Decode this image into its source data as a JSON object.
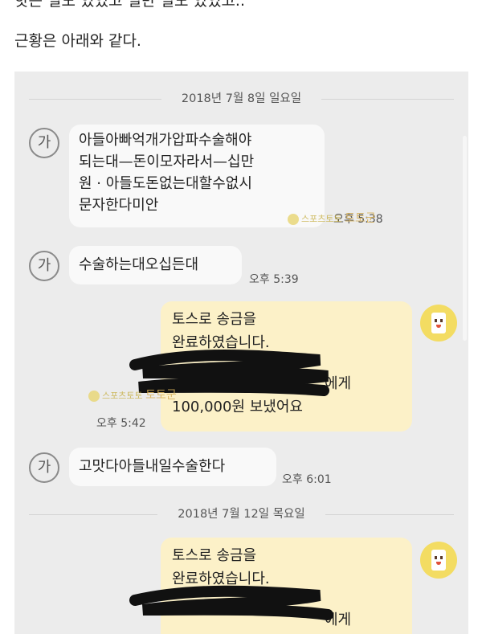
{
  "post": {
    "top_cut_text": "핫는 일도 있었고 일반 일도 있었고..",
    "intro_text": "근황은 아래와 같다."
  },
  "chat": {
    "dates": [
      "2018년 7월 8일 일요일",
      "2018년 7월 12일 목요일"
    ],
    "incoming_avatar_label": "가",
    "messages": [
      {
        "type": "in",
        "lines": [
          "아들아빠억개가압파수술해야",
          "되는대—돈이모자라서—십만",
          "원 · 아들도돈없는대할수없시",
          "문자한다미안"
        ],
        "time": "오후 5:38"
      },
      {
        "type": "in",
        "lines": [
          "수술하는대오십든대"
        ],
        "time": "오후 5:39"
      },
      {
        "type": "out",
        "lines": [
          "토스로 송금을",
          "완료하였습니다.",
          "에게",
          "100,000원 보냈어요"
        ],
        "time": "오후 5:42"
      },
      {
        "type": "in",
        "lines": [
          "고맛다아들내일수술한다"
        ],
        "time": "오후 6:01"
      },
      {
        "type": "out",
        "lines": [
          "토스로 송금을",
          "완료하였습니다.",
          "에게"
        ],
        "time": ""
      }
    ]
  },
  "watermark": {
    "text": "스포츠토토",
    "kr": "토토군"
  },
  "colors": {
    "chat_bg": "#ececec",
    "bubble_out": "#fcf1c8",
    "bubble_in": "#f9f9f9",
    "avatar_me": "#f3dc62"
  }
}
